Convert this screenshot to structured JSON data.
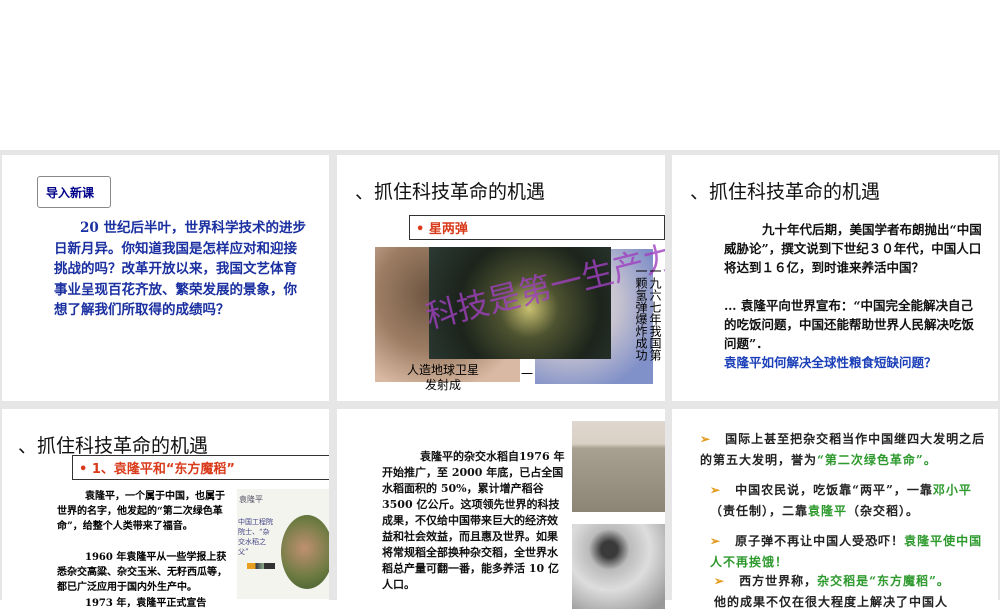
{
  "slides": [
    {
      "badge": "导入新课",
      "text": "20 世纪后半叶，世界科学技术的进步日新月异。你知道我国是怎样应对和迎接挑战的吗？改革开放以来，我国文艺体育事业呈现百花齐放、繁荣发展的景象，你想了解我们所取得的成绩吗？"
    },
    {
      "title": "、抓住科技革命的机遇",
      "box": "• 星两弹",
      "wordart": "科技是第一生产力!",
      "caption_left": "人造地球卫星发射成",
      "caption_right_1": "一九六七年我国第",
      "caption_right_2": "一颗氢弹爆炸成功",
      "caption_mid": "一"
    },
    {
      "title": "、抓住科技革命的机遇",
      "text": "九十年代后期，美国学者布朗抛出“中国威胁论”，撰文说到下世纪３０年代，中国人口将达到１６亿，到时谁来养活中国？",
      "text2": "… 袁隆平向世界宣布：“中国完全能解决自己的吃饭问题，中国还能帮助世界人民解决吃饭问题”．",
      "question": "袁隆平如何解决全球性粮食短缺问题？"
    },
    {
      "title": "、抓住科技革命的机遇",
      "box": "• 1、袁隆平和“东方魔稻”",
      "p1": "袁隆平，一个属于中国，也属于世界的名字，他发起的“第二次绿色革命”，给整个人类带来了福音。",
      "p2": "1960 年袁隆平从一些学报上获悉杂交高粱、杂交玉米、无籽西瓜等，都已广泛应用于国内外生产中。",
      "p3": "1973 年，袁隆平正式宣告",
      "img_label": "袁隆平",
      "img_caption": "中国工程院院士、“杂交水稻之父”"
    },
    {
      "text": "袁隆平的杂交水稻自1976 年开始推广，至 2000 年底，已占全国水稻面积的 50%，累计增产稻谷 3500 亿公斤。这项领先世界的科技成果，不仅给中国带来巨大的经济效益和社会效益，而且惠及世界。如果将常规稻全部换种杂交稻，全世界水稻总产量可翻一番，能多养活 10 亿人口。"
    },
    {
      "b1a": "国际上甚至把杂交稻当作中国继四大发明之后的第五大发明，誉为",
      "b1b": "“第二次绿色革命”。",
      "b2a": "中国农民说，吃饭靠“两平”，一靠",
      "b2b": "邓小平",
      "b2c": "（责任制），二靠",
      "b2d": "袁隆平",
      "b2e": "（杂交稻）。",
      "b3a": "原子弹不再让中国人受恐吓！",
      "b3b": "袁隆平使中国人不再挨饿！",
      "b4a": "西方世界称，",
      "b4b": "杂交稻是“东方魔稻”。",
      "b4c": "他的成果不仅在很大程度上解决了中国人",
      "bullet": "➢"
    }
  ]
}
